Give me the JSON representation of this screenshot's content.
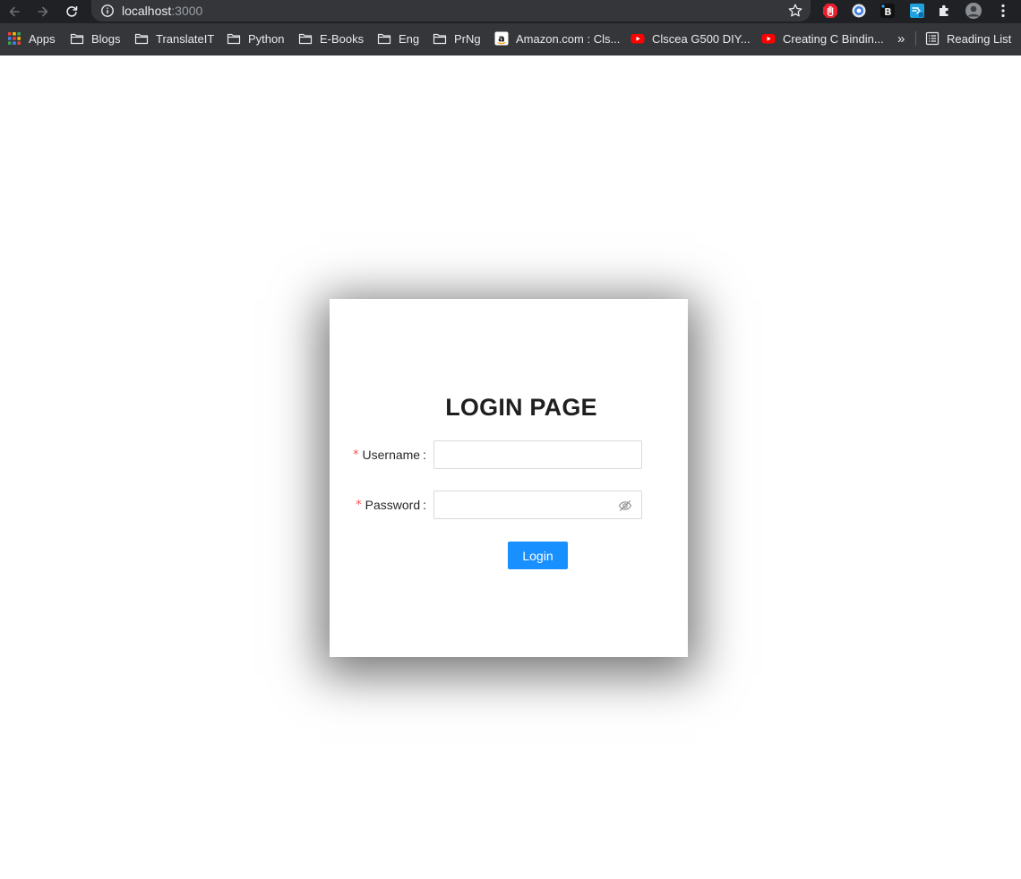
{
  "browser": {
    "url_host": "localhost",
    "url_port": ":3000",
    "bookmarks": [
      {
        "label": "Apps",
        "icon": "apps-grid-icon"
      },
      {
        "label": "Blogs",
        "icon": "folder-icon"
      },
      {
        "label": "TranslateIT",
        "icon": "folder-icon"
      },
      {
        "label": "Python",
        "icon": "folder-icon"
      },
      {
        "label": "E-Books",
        "icon": "folder-icon"
      },
      {
        "label": "Eng",
        "icon": "folder-icon"
      },
      {
        "label": "PrNg",
        "icon": "folder-icon"
      },
      {
        "label": "Amazon.com : Cls...",
        "icon": "amazon-icon"
      },
      {
        "label": "Clscea G500 DIY...",
        "icon": "youtube-icon"
      },
      {
        "label": "Creating C Bindin...",
        "icon": "youtube-icon"
      }
    ],
    "overflow_label": "»",
    "reading_list_label": "Reading List",
    "extension_b_label": "B"
  },
  "login": {
    "title": "LOGIN PAGE",
    "required_mark": "*",
    "username_label": "Username",
    "password_label": "Password",
    "colon": ":",
    "username_value": "",
    "password_value": "",
    "submit_label": "Login"
  },
  "colors": {
    "primary": "#1890ff",
    "required": "#ff4d4f",
    "chrome_dark": "#202124",
    "chrome_bar": "#35363a"
  }
}
